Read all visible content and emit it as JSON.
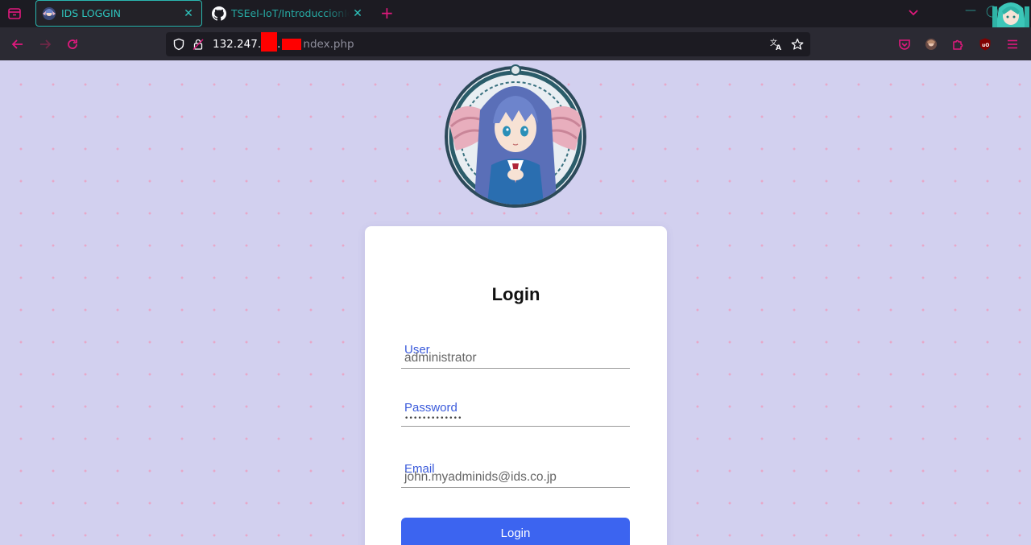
{
  "tabs": [
    {
      "title": "IDS LOGGIN",
      "active": true,
      "favicon": "anime-girl-favicon"
    },
    {
      "title": "TSEeI-IoT/IntroduccionIoT",
      "active": false,
      "favicon": "github-icon"
    }
  ],
  "urlbar": {
    "prefix": "132.247.",
    "dot": ".",
    "suffix": "ndex.php"
  },
  "login": {
    "title": "Login",
    "user_label": "User",
    "user_value": "administrator",
    "password_label": "Password",
    "password_mask": "•••••••••••••",
    "email_label": "Email",
    "email_value": "john.myadminids@ids.co.jp",
    "button_label": "Login"
  },
  "colors": {
    "accent_pink": "#e0197d",
    "tab_teal": "#2ec4bd",
    "page_bg": "#d2d0ef",
    "link_blue": "#3b5bdb",
    "button_blue": "#3c64f0"
  }
}
